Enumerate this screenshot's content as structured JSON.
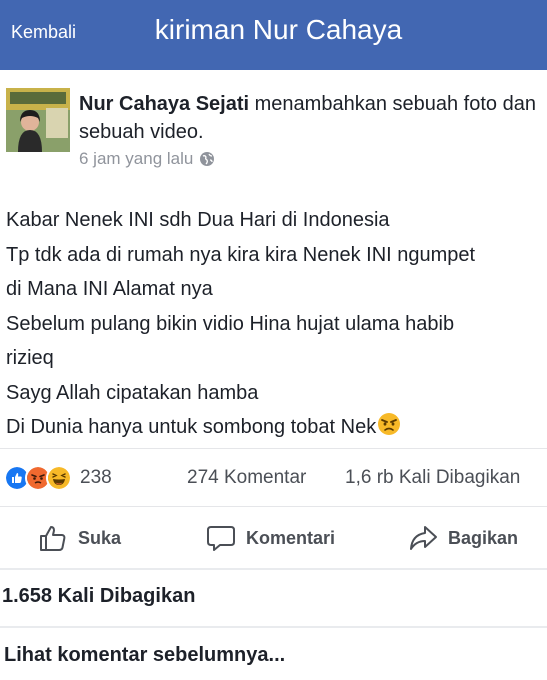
{
  "header": {
    "back_label": "Kembali",
    "title": "kiriman Nur Cahaya"
  },
  "post": {
    "author": "Nur Cahaya Sejati",
    "action_text": " menambahkan sebuah foto dan sebuah video.",
    "timestamp": "6 jam yang lalu",
    "privacy_icon": "globe-icon",
    "body_lines": [
      "Kabar Nenek INI sdh Dua Hari di Indonesia",
      "Tp tdk ada di rumah nya kira kira Nenek INI ngumpet",
      "di Mana INI Alamat nya",
      "Sebelum pulang bikin vidio Hina hujat ulama habib",
      "rizieq",
      "Sayg Allah cipatakan hamba",
      "Di Dunia hanya untuk sombong tobat Nek"
    ]
  },
  "stats": {
    "reaction_icons": [
      "like-icon",
      "angry-icon",
      "haha-icon"
    ],
    "reaction_count": "238",
    "comments": "274 Komentar",
    "shares": "1,6 rb Kali Dibagikan"
  },
  "actions": {
    "like": "Suka",
    "comment": "Komentari",
    "share": "Bagikan"
  },
  "shares_section": "1.658 Kali Dibagikan",
  "see_more": "Lihat komentar sebelumnya...",
  "colors": {
    "header_bg": "#4267b2",
    "like_blue": "#1877f2",
    "angry_orange": "#f0692f",
    "haha_yellow": "#f7b928",
    "muted_text": "#90949c"
  }
}
